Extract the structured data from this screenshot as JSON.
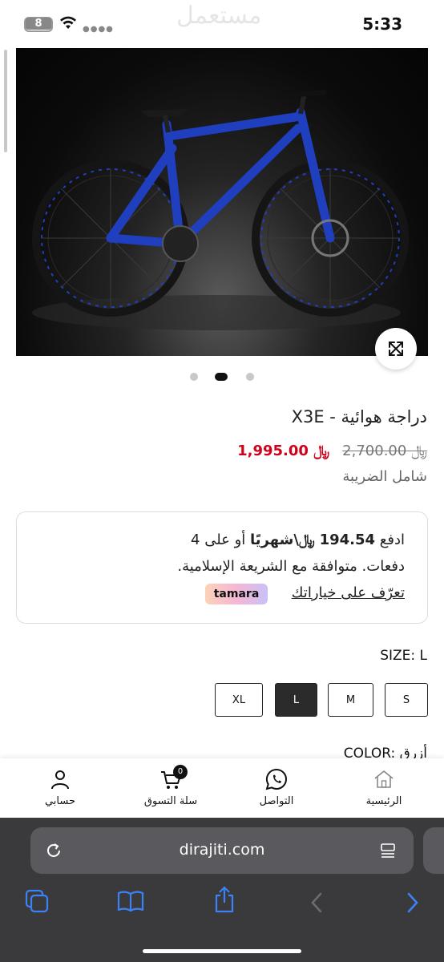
{
  "status_bar": {
    "battery_level": "8",
    "time": "5:33",
    "watermark": "مستعمل"
  },
  "product": {
    "title": "دراجة هوائية - X3E",
    "old_price": "2,700.00",
    "sale_price": "1,995.00",
    "currency_symbol": "﷼",
    "tax_note": "شامل الضريبة",
    "gallery": {
      "slide_count": 3,
      "active_index": 1
    }
  },
  "tamara": {
    "line1_pay": "ادفع",
    "line1_amount": "194.54",
    "line1_rest": "\\شهريًا",
    "line1_tail": "أو على 4",
    "line2": "دفعات. متوافقة مع الشريعة الإسلامية.",
    "link": "تعرّف على خياراتك",
    "badge": "tamara"
  },
  "options": {
    "size_label": "SIZE: L",
    "sizes": [
      "XL",
      "L",
      "M",
      "S"
    ],
    "selected_size": "L",
    "color_label": "COLOR: أزرق"
  },
  "bottom_nav": {
    "account": "حسابي",
    "cart": "سلة التسوق",
    "cart_count": "0",
    "contact": "التواصل",
    "home": "الرئيسية"
  },
  "browser": {
    "url": "dirajiti.com"
  },
  "colors": {
    "sale": "#d0021b",
    "frame": "#1f3fbf",
    "toolbar_blue": "#3b82f6"
  }
}
